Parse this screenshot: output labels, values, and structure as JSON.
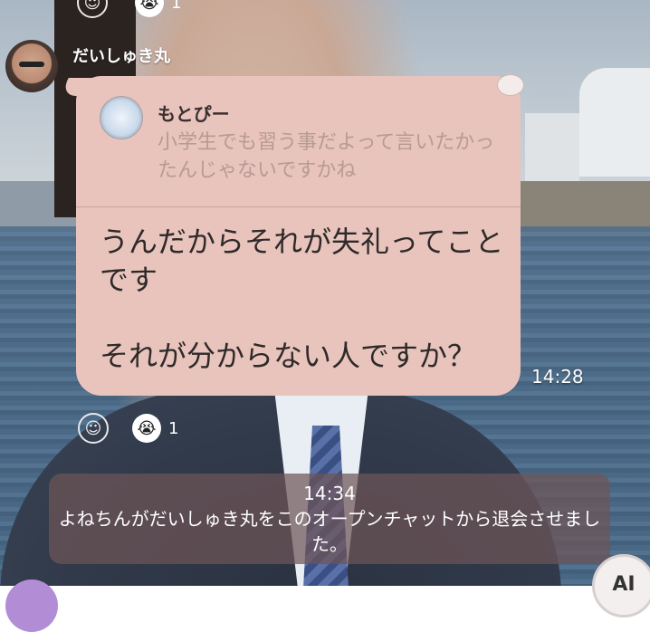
{
  "top_reaction": {
    "count": "1"
  },
  "message": {
    "sender": "だいしゅき丸",
    "reply": {
      "name": "もとぴー",
      "text": "小学生でも習う事だよって言いたかったんじゃないですかね"
    },
    "text": "うんだからそれが失礼ってことです\n\nそれが分からない人ですか？",
    "time": "14:28",
    "reaction_count": "1"
  },
  "system": {
    "time": "14:34",
    "text": "よねちんがだいしゅき丸をこのオープンチャットから退会させました。"
  },
  "icons": {
    "reaction": "smiley-outline-icon",
    "sticker": "crying-face-sticker-icon"
  },
  "ai_button": {
    "label": "AI"
  }
}
